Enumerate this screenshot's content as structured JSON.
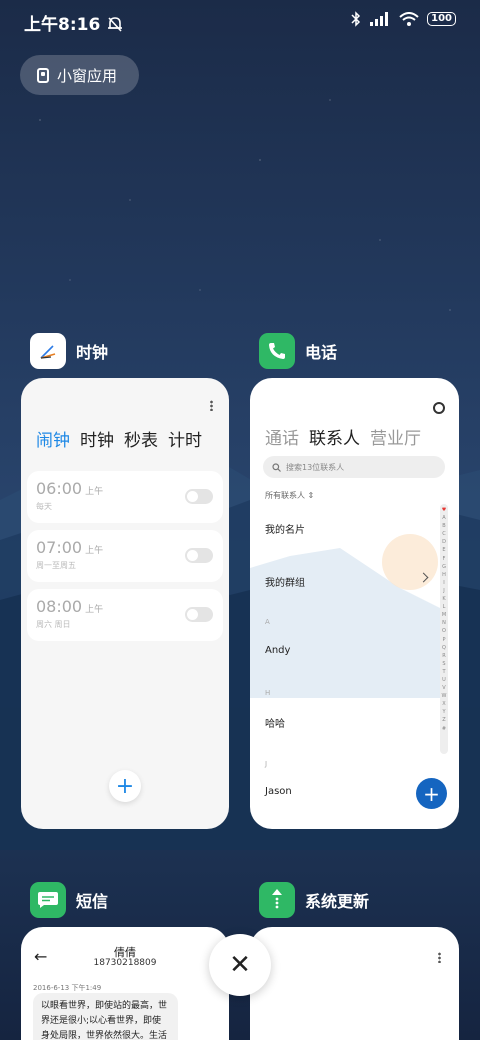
{
  "status_bar": {
    "time": "上午8:16",
    "battery": "100"
  },
  "float_window": {
    "label": "小窗应用"
  },
  "apps": {
    "clock": {
      "name": "时钟",
      "tabs": [
        "闹钟",
        "时钟",
        "秒表",
        "计时"
      ],
      "alarms": [
        {
          "time": "06:00",
          "ampm": "上午",
          "repeat": "每天"
        },
        {
          "time": "07:00",
          "ampm": "上午",
          "repeat": "周一至周五"
        },
        {
          "time": "08:00",
          "ampm": "上午",
          "repeat": "周六 周日"
        }
      ],
      "add": "+"
    },
    "phone": {
      "name": "电话",
      "tabs": [
        "通话",
        "联系人",
        "营业厅"
      ],
      "search_placeholder": "搜索13位联系人",
      "filter": "所有联系人",
      "my_card": "我的名片",
      "my_groups": "我的群组",
      "letters": [
        "A",
        "H",
        "J"
      ],
      "contacts": [
        "Andy",
        "哈哈",
        "Jason"
      ],
      "index": [
        "♥",
        "A",
        "B",
        "C",
        "D",
        "E",
        "F",
        "G",
        "H",
        "I",
        "J",
        "K",
        "L",
        "M",
        "N",
        "O",
        "P",
        "Q",
        "R",
        "S",
        "T",
        "U",
        "V",
        "W",
        "X",
        "Y",
        "Z",
        "#"
      ],
      "add": "+"
    },
    "sms": {
      "name": "短信",
      "contact_name": "倩倩",
      "contact_number": "18730218809",
      "date": "2016-6-13 下午1:49",
      "message": "以眼看世界，即使站的最高，世界还是很小;以心看世界，即使身处局限，世界依然很大。生活远"
    },
    "update": {
      "name": "系统更新"
    }
  },
  "close_label": "✕"
}
